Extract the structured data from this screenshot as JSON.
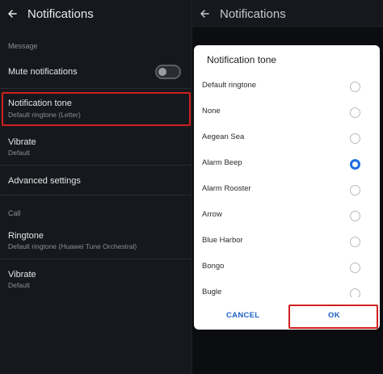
{
  "left_screen": {
    "title": "Notifications",
    "message_section": "Message",
    "mute": {
      "label": "Mute notifications",
      "enabled": false
    },
    "notification_tone": {
      "title": "Notification tone",
      "value": "Default ringtone (Letter)"
    },
    "vibrate": {
      "title": "Vibrate",
      "value": "Default"
    },
    "advanced": {
      "title": "Advanced settings"
    },
    "call_section": "Call",
    "ringtone": {
      "title": "Ringtone",
      "value": "Default ringtone (Huawei Tune Orchestral)"
    },
    "call_vibrate": {
      "title": "Vibrate",
      "value": "Default"
    }
  },
  "right_screen": {
    "title": "Notifications"
  },
  "dialog": {
    "title": "Notification tone",
    "options": [
      {
        "label": "Default ringtone",
        "selected": false
      },
      {
        "label": "None",
        "selected": false
      },
      {
        "label": "Aegean Sea",
        "selected": false
      },
      {
        "label": "Alarm Beep",
        "selected": true
      },
      {
        "label": "Alarm Rooster",
        "selected": false
      },
      {
        "label": "Arrow",
        "selected": false
      },
      {
        "label": "Blue Harbor",
        "selected": false
      },
      {
        "label": "Bongo",
        "selected": false
      },
      {
        "label": "Bugle",
        "selected": false
      }
    ],
    "cancel_label": "CANCEL",
    "ok_label": "OK"
  },
  "colors": {
    "accent": "#1b6fe0",
    "highlight": "#d0201f",
    "background": "#16181d"
  }
}
